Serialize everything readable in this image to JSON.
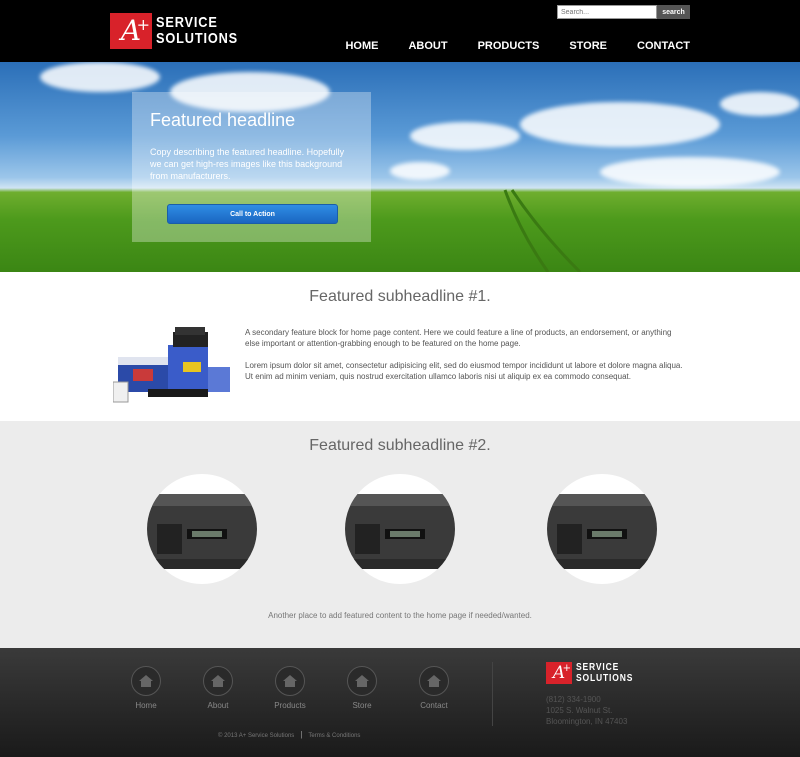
{
  "brand": {
    "mark": "A",
    "plus": "+",
    "line1": "SERVICE",
    "line2": "SOLUTIONS"
  },
  "search": {
    "placeholder": "Search...",
    "button": "search"
  },
  "nav": [
    "HOME",
    "ABOUT",
    "PRODUCTS",
    "STORE",
    "CONTACT"
  ],
  "hero": {
    "title": "Featured headline",
    "copy": "Copy describing the featured headline. Hopefully we can get high-res images like this background from manufacturers.",
    "cta": "Call to Action"
  },
  "feature1": {
    "title": "Featured subheadline #1.",
    "p1": "A secondary feature block for home page content. Here we could feature a line of products, an endorsement, or anything else important or attention-grabbing enough to be featured on the home page.",
    "p2": "Lorem ipsum dolor sit amet, consectetur adipisicing elit, sed do eiusmod tempor incididunt ut labore et dolore magna aliqua. Ut enim ad minim veniam, quis nostrud exercitation ullamco laboris nisi ut aliquip ex ea commodo consequat."
  },
  "feature2": {
    "title": "Featured subheadline #2.",
    "caption": "Another place to add featured content to the home page if needed/wanted."
  },
  "footer": {
    "nav": [
      "Home",
      "About",
      "Products",
      "Store",
      "Contact"
    ],
    "phone": "(812) 334-1900",
    "street": "1025 S. Walnut St.",
    "city": "Bloomington, IN 47403",
    "copyright": "© 2013 A+ Service Solutions",
    "sep": "|",
    "terms": "Terms & Conditions"
  },
  "colors": {
    "brand_red": "#d8222a",
    "cta_blue": "#1a66c2"
  },
  "icons": {
    "footer_nav": "home-icon"
  }
}
